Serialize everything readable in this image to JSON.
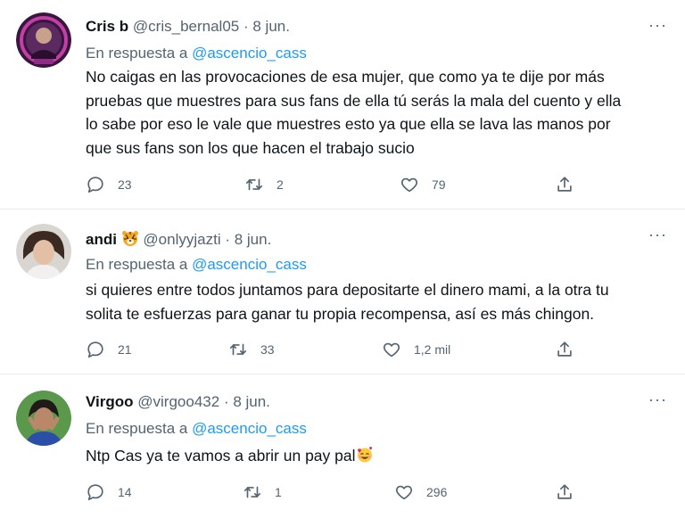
{
  "tweets": [
    {
      "name": "Cris b",
      "handle": "@cris_bernal05",
      "date": "· 8 jun.",
      "reply_prefix": "En respuesta a",
      "reply_to": "@ascencio_cass",
      "lines": [
        "No caigas en las provocaciones de esa mujer, que como ya te dije por más",
        "pruebas que muestres para sus fans de ella tú serás la mala del cuento y ella",
        "lo sabe por eso le vale que muestres esto ya que ella se lava las manos por",
        "que sus fans son los que hacen el trabajo sucio"
      ],
      "replies": "23",
      "retweets": "2",
      "likes": "79",
      "more": "···"
    },
    {
      "name": "andi",
      "badge_emoji": "tiger-face",
      "handle": "@onlyyjazti",
      "date": "· 8 jun.",
      "reply_prefix": "En respuesta a",
      "reply_to": "@ascencio_cass",
      "lines": [
        "si quieres entre todos juntamos para depositarte el dinero mami, a la otra tu",
        "solita te esfuerzas para ganar tu propia recompensa, así es más chingon."
      ],
      "replies": "21",
      "retweets": "33",
      "likes": "1,2 mil",
      "more": "···"
    },
    {
      "name": "Virgoo",
      "handle": "@virgoo432",
      "date": "· 8 jun.",
      "reply_prefix": "En respuesta a",
      "reply_to": "@ascencio_cass",
      "lines": [
        "Ntp Cas ya te vamos a abrir un pay pal"
      ],
      "trailing_emoji": "smiling-face-with-hearts",
      "replies": "14",
      "retweets": "1",
      "likes": "296",
      "more": "···"
    }
  ],
  "colors": {
    "link": "#1d9bf0",
    "secondary_text": "#536471",
    "divider": "#e6ecf0"
  }
}
